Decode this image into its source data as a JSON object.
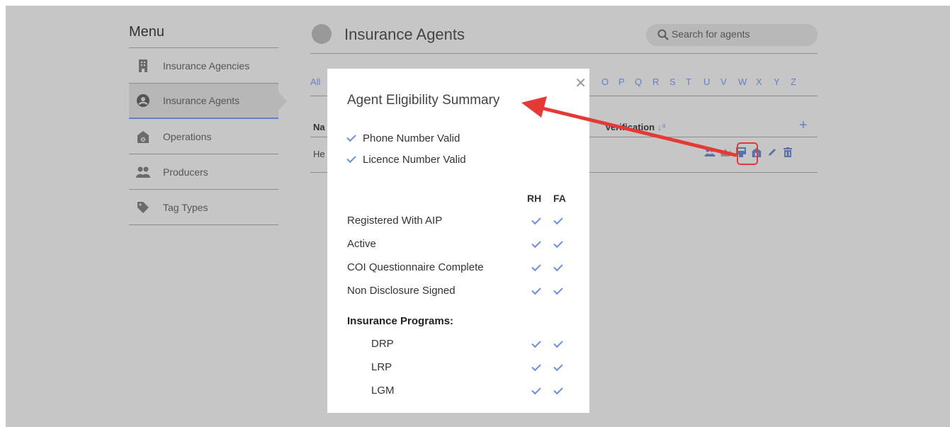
{
  "menu": {
    "title": "Menu",
    "items": [
      {
        "label": "Insurance Agencies",
        "icon": "building-icon"
      },
      {
        "label": "Insurance Agents",
        "icon": "user-circle-icon",
        "active": true
      },
      {
        "label": "Operations",
        "icon": "barn-icon"
      },
      {
        "label": "Producers",
        "icon": "users-icon"
      },
      {
        "label": "Tag Types",
        "icon": "tag-icon"
      }
    ]
  },
  "main": {
    "title": "Insurance Agents",
    "search_placeholder": "Search for agents",
    "alpha_first": "All",
    "alpha_letters": [
      "O",
      "P",
      "Q",
      "R",
      "S",
      "T",
      "U",
      "V",
      "W",
      "X",
      "Y",
      "Z"
    ],
    "table": {
      "name_header_partial": "Na",
      "verification_header": "Verification",
      "sort_icon": "sort-numeric-icon",
      "add_icon": "plus-icon",
      "row_partial": "He"
    }
  },
  "modal": {
    "title": "Agent Eligibility Summary",
    "close_glyph": "✕",
    "validations": [
      "Phone Number Valid",
      "Licence Number Valid"
    ],
    "columns": [
      "RH",
      "FA"
    ],
    "rows": [
      {
        "label": "Registered With AIP",
        "rh": true,
        "fa": true
      },
      {
        "label": "Active",
        "rh": true,
        "fa": true
      },
      {
        "label": "COI Questionnaire Complete",
        "rh": true,
        "fa": true
      },
      {
        "label": "Non Disclosure Signed",
        "rh": true,
        "fa": true
      }
    ],
    "programs_heading": "Insurance Programs:",
    "programs": [
      {
        "label": "DRP",
        "rh": true,
        "fa": true
      },
      {
        "label": "LRP",
        "rh": true,
        "fa": true
      },
      {
        "label": "LGM",
        "rh": true,
        "fa": true
      }
    ]
  },
  "colors": {
    "accent": "#6b8fe0",
    "overlay": "#c6c6c6",
    "annotation": "#e53935"
  }
}
